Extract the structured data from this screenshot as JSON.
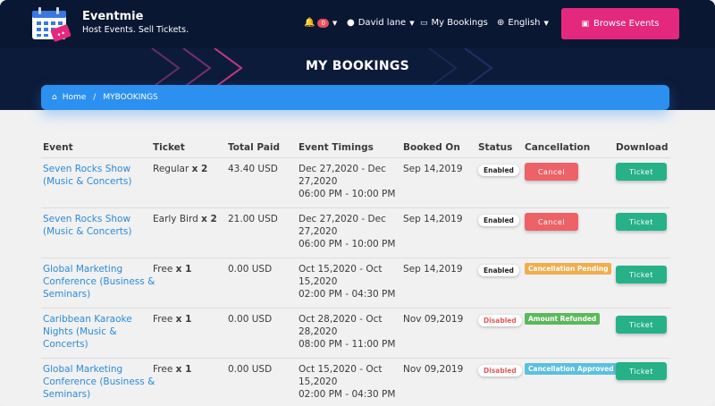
{
  "brand": {
    "name": "Eventmie",
    "tagline": "Host Events. Sell Tickets."
  },
  "nav": {
    "notification_count": "0",
    "user_name": "David lane",
    "bookings_label": "My Bookings",
    "language": "English",
    "browse_label": "Browse Events"
  },
  "page": {
    "title": "MY BOOKINGS"
  },
  "breadcrumb": {
    "home": "Home",
    "current": "MYBOOKINGS"
  },
  "table": {
    "headers": {
      "event": "Event",
      "ticket": "Ticket",
      "total_paid": "Total Paid",
      "event_timings": "Event Timings",
      "booked_on": "Booked On",
      "status": "Status",
      "cancellation": "Cancellation",
      "download": "Download"
    },
    "rows": [
      {
        "event_line1": "Seven Rocks Show",
        "event_line2": "(Music & Concerts)",
        "event_line3": "",
        "ticket_name": "Regular",
        "ticket_qty": "x 2",
        "total_paid": "43.40 USD",
        "timing_line1": "Dec 27,2020 - Dec",
        "timing_line2": "27,2020",
        "timing_line3": "06:00 PM - 10:00 PM",
        "booked_on": "Sep 14,2019",
        "status": "Enabled",
        "cancellation": "Cancel",
        "download": "Ticket"
      },
      {
        "event_line1": "Seven Rocks Show",
        "event_line2": "(Music & Concerts)",
        "event_line3": "",
        "ticket_name": "Early Bird",
        "ticket_qty": "x 2",
        "total_paid": "21.00 USD",
        "timing_line1": "Dec 27,2020 - Dec",
        "timing_line2": "27,2020",
        "timing_line3": "06:00 PM - 10:00 PM",
        "booked_on": "Sep 14,2019",
        "status": "Enabled",
        "cancellation": "Cancel",
        "download": "Ticket"
      },
      {
        "event_line1": "Global Marketing",
        "event_line2": "Conference (Business &",
        "event_line3": "Seminars)",
        "ticket_name": "Free",
        "ticket_qty": "x 1",
        "total_paid": "0.00 USD",
        "timing_line1": "Oct 15,2020 - Oct",
        "timing_line2": "15,2020",
        "timing_line3": "02:00 PM - 04:30 PM",
        "booked_on": "Sep 14,2019",
        "status": "Enabled",
        "cancellation": "Cancellation Pending",
        "download": "Ticket"
      },
      {
        "event_line1": "Caribbean Karaoke",
        "event_line2": "Nights (Music &",
        "event_line3": "Concerts)",
        "ticket_name": "Free",
        "ticket_qty": "x 1",
        "total_paid": "0.00 USD",
        "timing_line1": "Oct 28,2020 - Oct",
        "timing_line2": "28,2020",
        "timing_line3": "08:00 PM - 11:00 PM",
        "booked_on": "Nov 09,2019",
        "status": "Disabled",
        "cancellation": "Amount Refunded",
        "download": "Ticket"
      },
      {
        "event_line1": "Global Marketing",
        "event_line2": "Conference (Business &",
        "event_line3": "Seminars)",
        "ticket_name": "Free",
        "ticket_qty": "x 1",
        "total_paid": "0.00 USD",
        "timing_line1": "Oct 15,2020 - Oct",
        "timing_line2": "15,2020",
        "timing_line3": "02:00 PM - 04:30 PM",
        "booked_on": "Nov 09,2019",
        "status": "Disabled",
        "cancellation": "Cancellation Approved",
        "download": "Ticket"
      }
    ]
  },
  "colors": {
    "header_bg": "#0a1733",
    "accent_pink": "#e4287d",
    "breadcrumb_blue": "#2c90f0",
    "ticket_green": "#27b189",
    "cancel_red": "#ec6266",
    "pending_orange": "#f0ad4e",
    "refunded_green": "#5cb85c",
    "approved_blue": "#5bc0de"
  }
}
